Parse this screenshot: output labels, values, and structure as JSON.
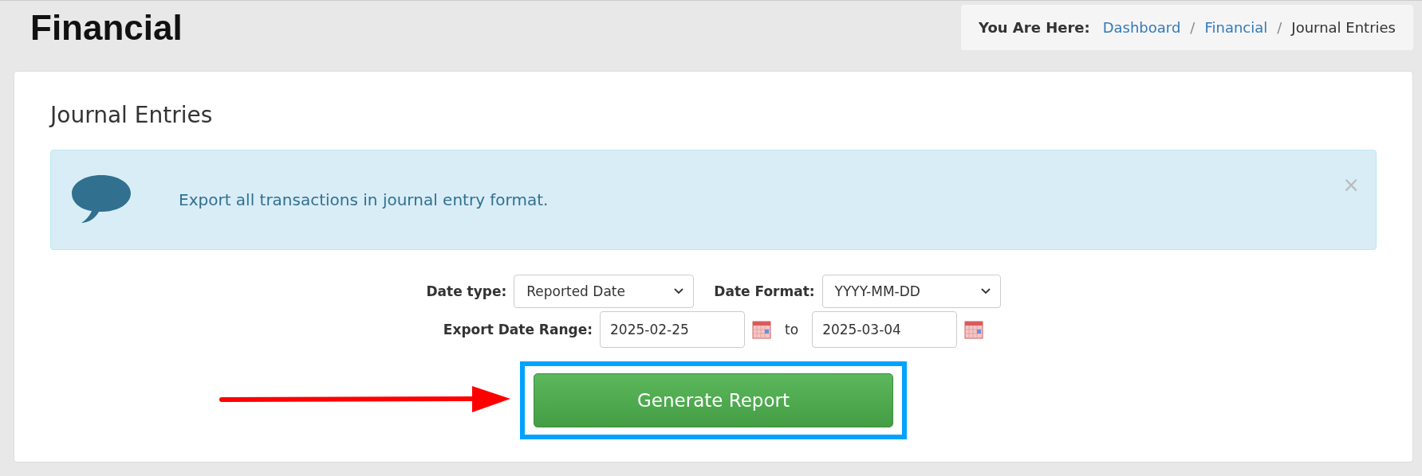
{
  "page_title": "Financial",
  "breadcrumb": {
    "label": "You Are Here:",
    "items": [
      {
        "text": "Dashboard",
        "link": true
      },
      {
        "text": "Financial",
        "link": true,
        "separator": "/"
      },
      {
        "text": "Journal Entries",
        "link": false,
        "separator": "/"
      }
    ]
  },
  "panel": {
    "heading": "Journal Entries"
  },
  "alert": {
    "text": "Export all transactions in journal entry format.",
    "close": "×"
  },
  "form": {
    "date_type": {
      "label": "Date type:",
      "value": "Reported Date"
    },
    "date_format": {
      "label": "Date Format:",
      "value": "YYYY-MM-DD"
    },
    "range": {
      "label": "Export Date Range:",
      "from": "2025-02-25",
      "joiner": "to",
      "to": "2025-03-04"
    }
  },
  "button": {
    "label": "Generate Report"
  }
}
